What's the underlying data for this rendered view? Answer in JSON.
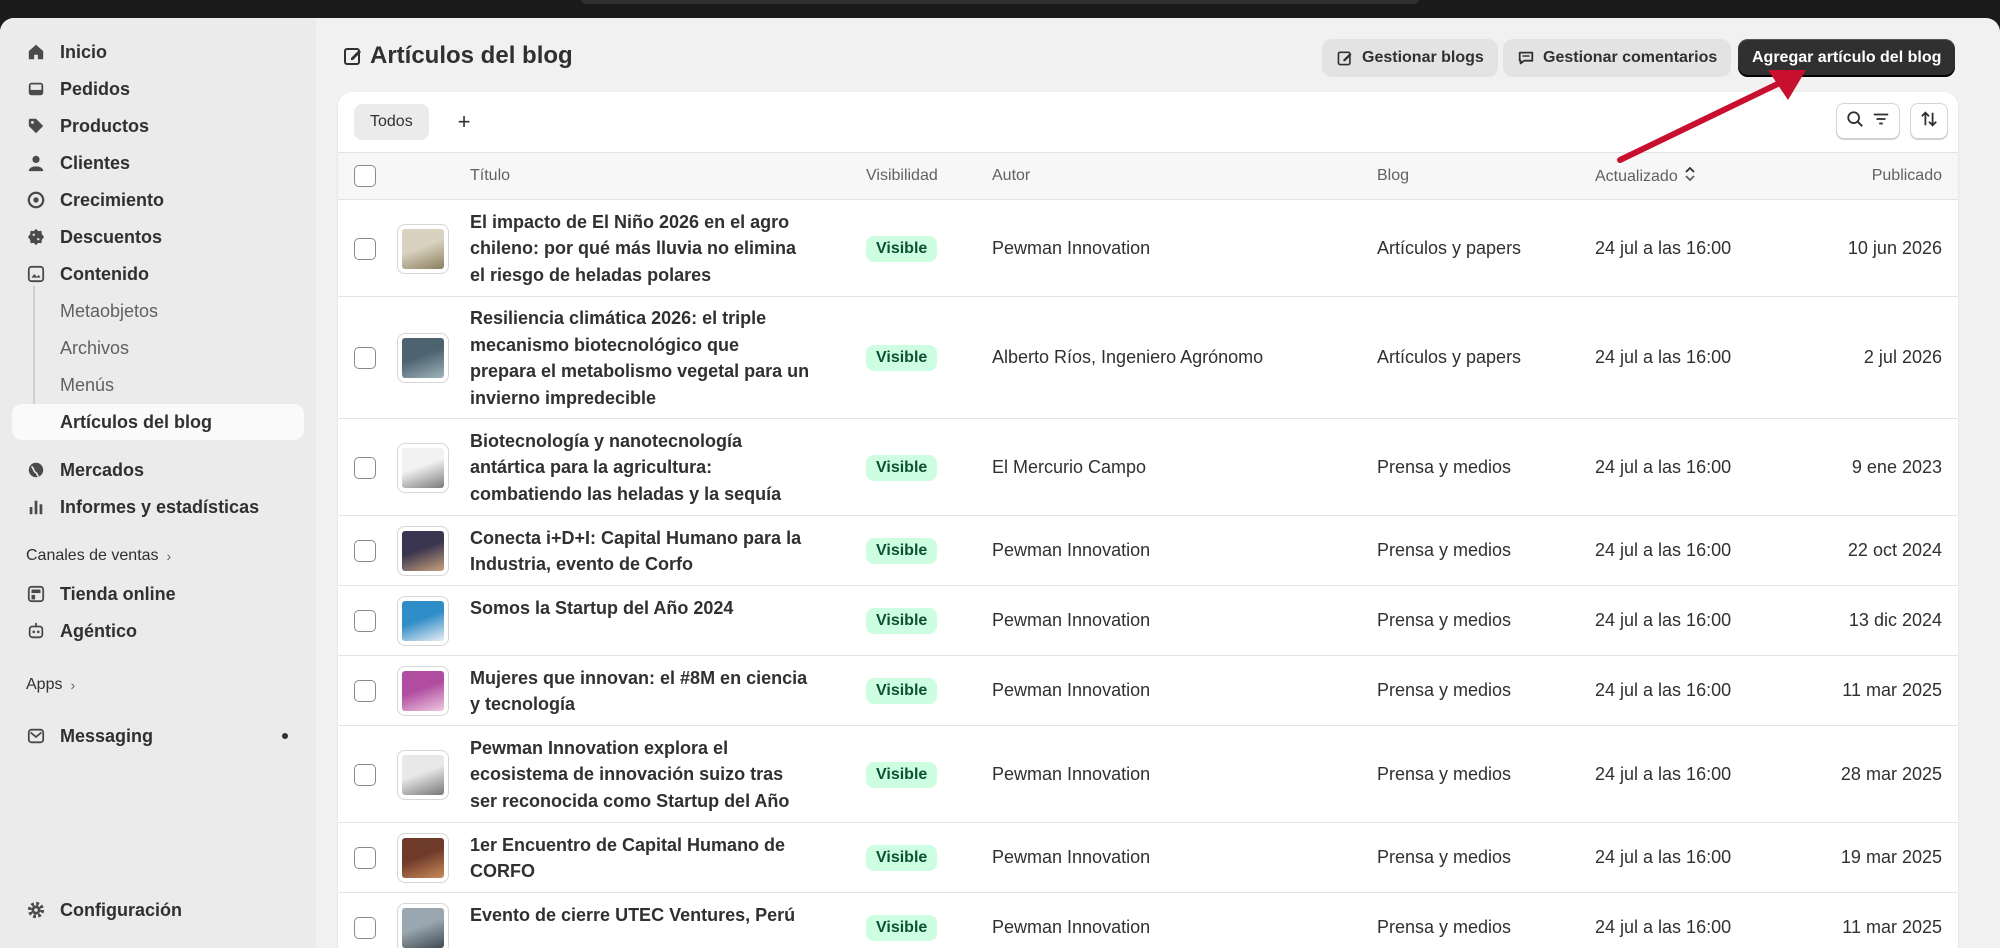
{
  "sidebar": {
    "items": [
      {
        "label": "Inicio",
        "icon": "home-icon"
      },
      {
        "label": "Pedidos",
        "icon": "inbox-icon"
      },
      {
        "label": "Productos",
        "icon": "tag-icon"
      },
      {
        "label": "Clientes",
        "icon": "person-icon"
      },
      {
        "label": "Crecimiento",
        "icon": "target-icon"
      },
      {
        "label": "Descuentos",
        "icon": "discount-icon"
      },
      {
        "label": "Contenido",
        "icon": "image-icon"
      }
    ],
    "sub_items": [
      "Metaobjetos",
      "Archivos",
      "Menús",
      "Artículos del blog"
    ],
    "items2": [
      {
        "label": "Mercados",
        "icon": "globe-icon"
      },
      {
        "label": "Informes y estadísticas",
        "icon": "chart-icon"
      }
    ],
    "sales_channels_label": "Canales de ventas",
    "channels": [
      {
        "label": "Tienda online",
        "icon": "store-icon"
      },
      {
        "label": "Agéntico",
        "icon": "robot-icon"
      }
    ],
    "apps_label": "Apps",
    "messaging": {
      "label": "Messaging",
      "icon": "mail-icon"
    },
    "settings": {
      "label": "Configuración",
      "icon": "gear-icon"
    }
  },
  "header": {
    "title": "Artículos del blog",
    "manage_blogs": "Gestionar blogs",
    "manage_comments": "Gestionar comentarios",
    "add_article": "Agregar artículo del blog"
  },
  "tabs": {
    "all": "Todos",
    "add": "+"
  },
  "table": {
    "columns": {
      "title": "Título",
      "visibility": "Visibilidad",
      "author": "Autor",
      "blog": "Blog",
      "updated": "Actualizado",
      "published": "Publicado"
    },
    "rows": [
      {
        "title": "El impacto de El Niño 2026 en el agro chileno: por qué más lluvia no elimina el riesgo de heladas polares",
        "visibility": "Visible",
        "author": "Pewman Innovation",
        "blog": "Artículos y papers",
        "updated": "24 jul a las 16:00",
        "published": "10 jun 2026"
      },
      {
        "title": "Resiliencia climática 2026: el triple mecanismo biotecnológico que prepara el metabolismo vegetal para un invierno impredecible",
        "visibility": "Visible",
        "author": "Alberto Ríos, Ingeniero Agrónomo",
        "blog": "Artículos y papers",
        "updated": "24 jul a las 16:00",
        "published": "2 jul 2026"
      },
      {
        "title": "Biotecnología y nanotecnología antártica para la agricultura: combatiendo las heladas y la sequía",
        "visibility": "Visible",
        "author": "El Mercurio Campo",
        "blog": "Prensa y medios",
        "updated": "24 jul a las 16:00",
        "published": "9 ene 2023"
      },
      {
        "title": "Conecta i+D+I: Capital Humano para la Industria, evento de Corfo",
        "visibility": "Visible",
        "author": "Pewman Innovation",
        "blog": "Prensa y medios",
        "updated": "24 jul a las 16:00",
        "published": "22 oct 2024"
      },
      {
        "title": "Somos la Startup del Año 2024",
        "visibility": "Visible",
        "author": "Pewman Innovation",
        "blog": "Prensa y medios",
        "updated": "24 jul a las 16:00",
        "published": "13 dic 2024"
      },
      {
        "title": "Mujeres que innovan: el #8M en ciencia y tecnología",
        "visibility": "Visible",
        "author": "Pewman Innovation",
        "blog": "Prensa y medios",
        "updated": "24 jul a las 16:00",
        "published": "11 mar 2025"
      },
      {
        "title": "Pewman Innovation explora el ecosistema de innovación suizo tras ser reconocida como Startup del Año",
        "visibility": "Visible",
        "author": "Pewman Innovation",
        "blog": "Prensa y medios",
        "updated": "24 jul a las 16:00",
        "published": "28 mar 2025"
      },
      {
        "title": "1er Encuentro de Capital Humano de CORFO",
        "visibility": "Visible",
        "author": "Pewman Innovation",
        "blog": "Prensa y medios",
        "updated": "24 jul a las 16:00",
        "published": "19 mar 2025"
      },
      {
        "title": "Evento de cierre UTEC Ventures, Perú",
        "visibility": "Visible",
        "author": "Pewman Innovation",
        "blog": "Prensa y medios",
        "updated": "24 jul a las 16:00",
        "published": "11 mar 2025"
      }
    ]
  },
  "colors": {
    "accent_arrow": "#c8102e",
    "badge_bg": "#cdfee1",
    "badge_text": "#0c5132",
    "primary_button": "#303030"
  }
}
